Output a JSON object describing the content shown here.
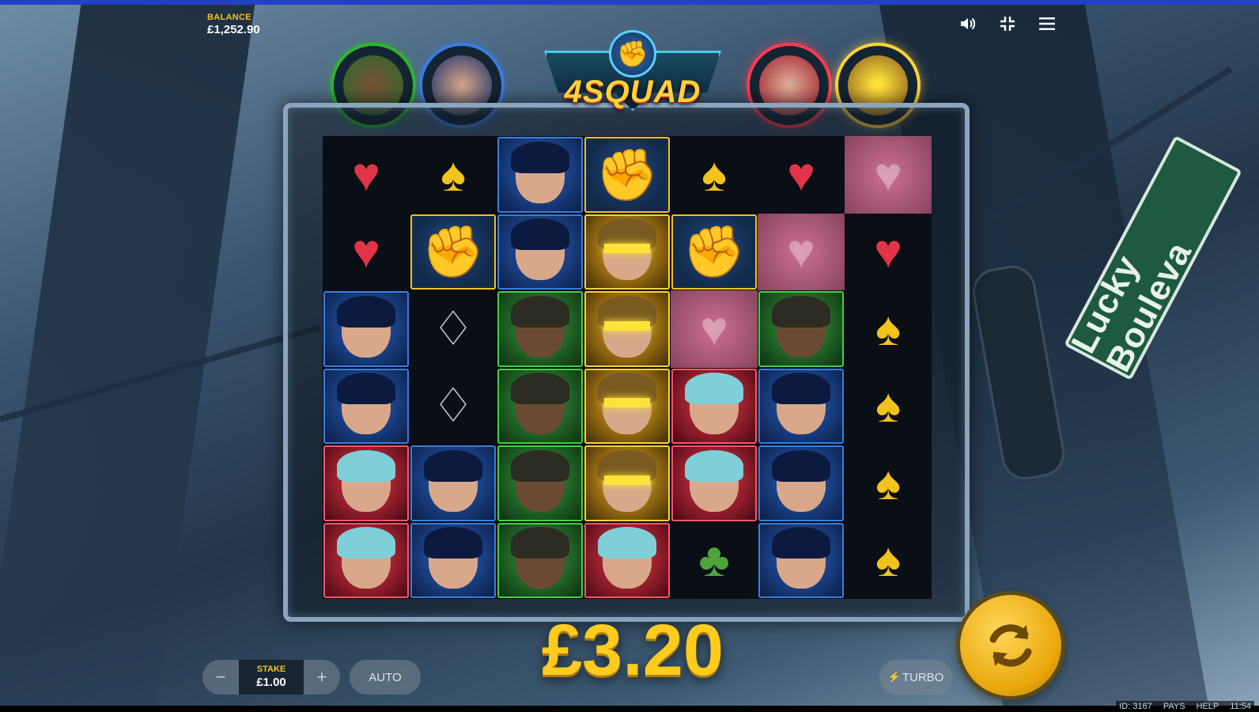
{
  "balance": {
    "label": "BALANCE",
    "value": "£1,252.90"
  },
  "logo": {
    "text": "4SQUAD",
    "emblem": "fist-icon"
  },
  "heroes": [
    {
      "name": "green-hero",
      "color": "#2fb52f"
    },
    {
      "name": "blue-hero",
      "color": "#3a7de0"
    },
    {
      "name": "red-hero",
      "color": "#ff3b4f"
    },
    {
      "name": "yellow-hero",
      "color": "#ffd23a"
    }
  ],
  "top_controls": {
    "sound": "speaker-icon",
    "fullscreen": "minimize-icon",
    "menu": "menu-icon"
  },
  "street_sign": "Lucky Bouleva",
  "grid": {
    "columns": 7,
    "rows": 6,
    "cells": [
      [
        "heart",
        "spade",
        "blue",
        "fist",
        "spade",
        "heart",
        "pink"
      ],
      [
        "heart",
        "fist",
        "blue",
        "yellow",
        "fist",
        "pink",
        "heart"
      ],
      [
        "blue",
        "diamond",
        "green",
        "yellow",
        "pink",
        "green",
        "spade"
      ],
      [
        "blue",
        "diamond",
        "green",
        "yellow",
        "red",
        "blue",
        "spade"
      ],
      [
        "red",
        "blue",
        "green",
        "yellow",
        "red",
        "blue",
        "spade"
      ],
      [
        "red",
        "blue",
        "green",
        "red",
        "club",
        "blue",
        "spade"
      ]
    ]
  },
  "win_amount": "£3.20",
  "stake": {
    "label": "STAKE",
    "value": "£1.00",
    "minus": "−",
    "plus": "+"
  },
  "auto_label": "AUTO",
  "turbo_label": "TURBO",
  "footer": {
    "id": "ID: 3167",
    "pays": "PAYS",
    "help": "HELP",
    "time": "11:54"
  }
}
